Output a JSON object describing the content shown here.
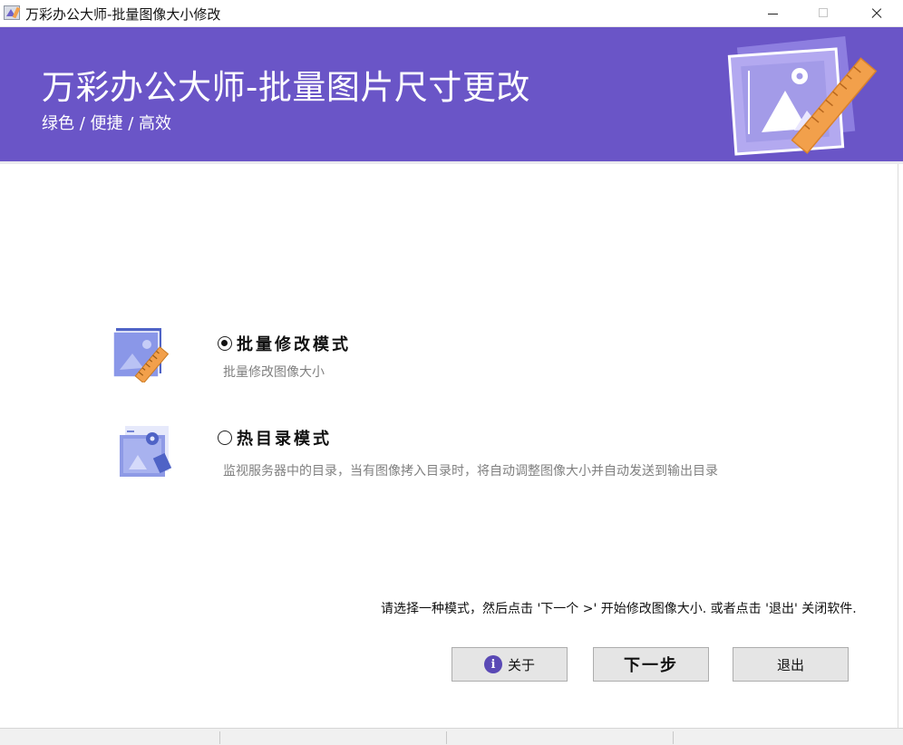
{
  "window": {
    "title": "万彩办公大师-批量图像大小修改"
  },
  "banner": {
    "title": "万彩办公大师-批量图片尺寸更改",
    "subtitle": "绿色 / 便捷 / 高效"
  },
  "modes": [
    {
      "label": "批量修改模式",
      "description": "批量修改图像大小",
      "selected": true,
      "icon": "image-ruler-icon"
    },
    {
      "label": "热目录模式",
      "description": "监视服务器中的目录，当有图像拷入目录时，将自动调整图像大小并自动发送到输出目录",
      "selected": false,
      "icon": "hot-folder-image-icon"
    }
  ],
  "instruction": "请选择一种模式，然后点击 '下一个 >' 开始修改图像大小. 或者点击 '退出' 关闭软件.",
  "buttons": {
    "about": "关于",
    "next": "下一步",
    "exit": "退出"
  },
  "colors": {
    "banner": "#6a55c7",
    "accent_orange": "#f2a04b",
    "info_icon": "#5a49b5"
  }
}
